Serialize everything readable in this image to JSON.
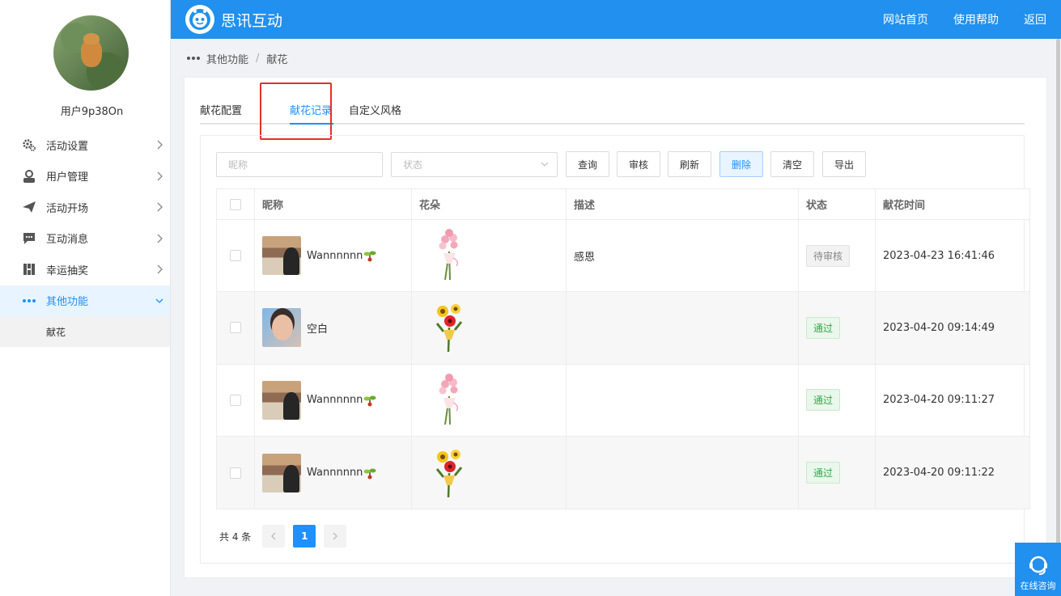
{
  "sidebar": {
    "username": "用户9p38On",
    "menu": [
      {
        "label": "活动设置",
        "icon": "gear-icon"
      },
      {
        "label": "用户管理",
        "icon": "user-icon"
      },
      {
        "label": "活动开场",
        "icon": "paper-plane-icon"
      },
      {
        "label": "互动消息",
        "icon": "chat-bubble-icon"
      },
      {
        "label": "幸运抽奖",
        "icon": "lottery-icon"
      },
      {
        "label": "其他功能",
        "icon": "more-dots-icon",
        "active": true
      }
    ],
    "submenu": [
      {
        "label": "献花"
      }
    ]
  },
  "header": {
    "brand": "思讯互动",
    "nav": [
      "网站首页",
      "使用帮助",
      "返回"
    ],
    "accent": "#2190ee"
  },
  "breadcrumb": {
    "parent": "其他功能",
    "separator": "/",
    "current": "献花"
  },
  "tabs": [
    {
      "label": "献花配置"
    },
    {
      "label": "献花记录",
      "active": true
    },
    {
      "label": "自定义风格"
    }
  ],
  "filters": {
    "nickname_placeholder": "昵称",
    "status_placeholder": "状态"
  },
  "toolbar": {
    "query": "查询",
    "review": "审核",
    "refresh": "刷新",
    "delete": "删除",
    "clear": "清空",
    "export": "导出"
  },
  "table": {
    "columns": [
      "昵称",
      "花朵",
      "描述",
      "状态",
      "献花时间"
    ],
    "rows": [
      {
        "nickname": "Wannnnnn",
        "flower": "pink-bouquet",
        "description": "感恩",
        "status": "待审核",
        "status_type": "pending",
        "time": "2023-04-23 16:41:46"
      },
      {
        "nickname": "空白",
        "flower": "sunflower-bouquet",
        "description": "",
        "status": "通过",
        "status_type": "ok",
        "time": "2023-04-20 09:14:49"
      },
      {
        "nickname": "Wannnnnn",
        "flower": "pink-bouquet",
        "description": "",
        "status": "通过",
        "status_type": "ok",
        "time": "2023-04-20 09:11:27"
      },
      {
        "nickname": "Wannnnnn",
        "flower": "sunflower-bouquet",
        "description": "",
        "status": "通过",
        "status_type": "ok",
        "time": "2023-04-20 09:11:22"
      }
    ]
  },
  "pager": {
    "total": "共 4 条",
    "current_page": "1"
  },
  "consult": {
    "label": "在线咨询"
  },
  "colors": {
    "accent": "#1e90ff",
    "highlight": "#e0322b",
    "status_ok": "#2faa47"
  }
}
